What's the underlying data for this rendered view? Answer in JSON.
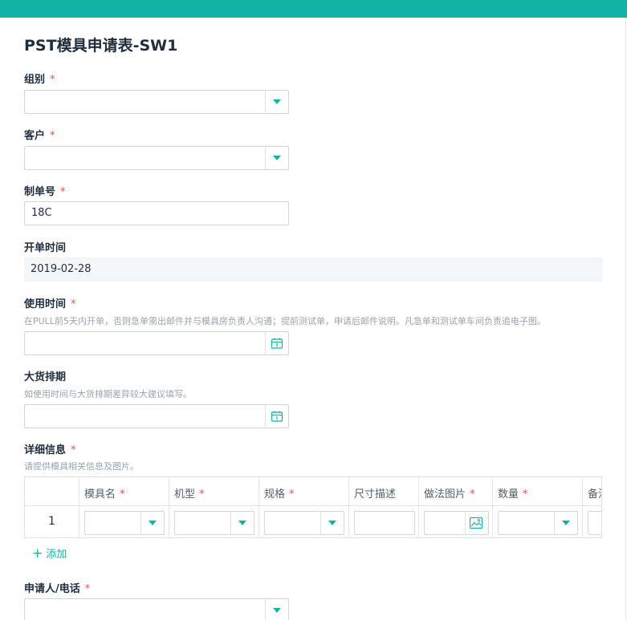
{
  "form": {
    "title": "PST模具申请表-SW1",
    "required_mark": "*"
  },
  "fields": {
    "group": {
      "label": "组别"
    },
    "customer": {
      "label": "客户"
    },
    "order_no": {
      "label": "制单号",
      "value": "18C"
    },
    "open_time": {
      "label": "开单时间",
      "value": "2019-02-28"
    },
    "use_time": {
      "label": "使用时间",
      "hint": "在PULL前5天内开单，否则急单需出邮件并与模具房负责人沟通；提前测试单，申请后邮件说明。凡急单和测试单车间负责追电子图。"
    },
    "bulk_schedule": {
      "label": "大货排期",
      "hint": "如使用时间与大货排期差异较大建议填写。"
    },
    "details": {
      "label": "详细信息",
      "hint": "请提供模具相关信息及图片。",
      "columns": [
        "模具名",
        "机型",
        "规格",
        "尺寸描述",
        "做法图片",
        "数量",
        "备注"
      ],
      "rows": [
        {
          "index": "1"
        }
      ],
      "add_label": "添加"
    },
    "applicant": {
      "label": "申请人/电话"
    }
  },
  "colors": {
    "accent": "#12b5a4",
    "required": "#ef4c4c"
  },
  "icons": {
    "dropdown": "chevron-down-icon",
    "date": "calendar-icon",
    "image": "image-icon",
    "add": "plus-icon"
  }
}
